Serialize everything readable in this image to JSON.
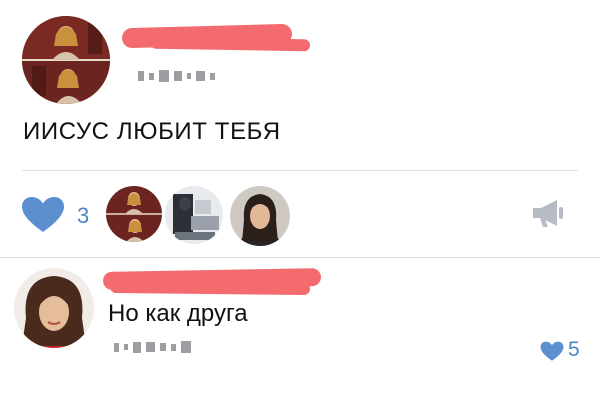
{
  "post": {
    "text": "ИИСУС ЛЮБИТ ТЕБЯ",
    "likes_count": "3"
  },
  "comment": {
    "text": "Но как друга",
    "likes_count": "5"
  },
  "colors": {
    "like_blue": "#5b8fd0",
    "redaction_pink": "#f36b6e",
    "text": "#111111",
    "divider": "#dcdfe4",
    "share_gray": "#b7bcc4"
  },
  "icons": {
    "like": "heart-icon",
    "share": "megaphone-icon"
  }
}
